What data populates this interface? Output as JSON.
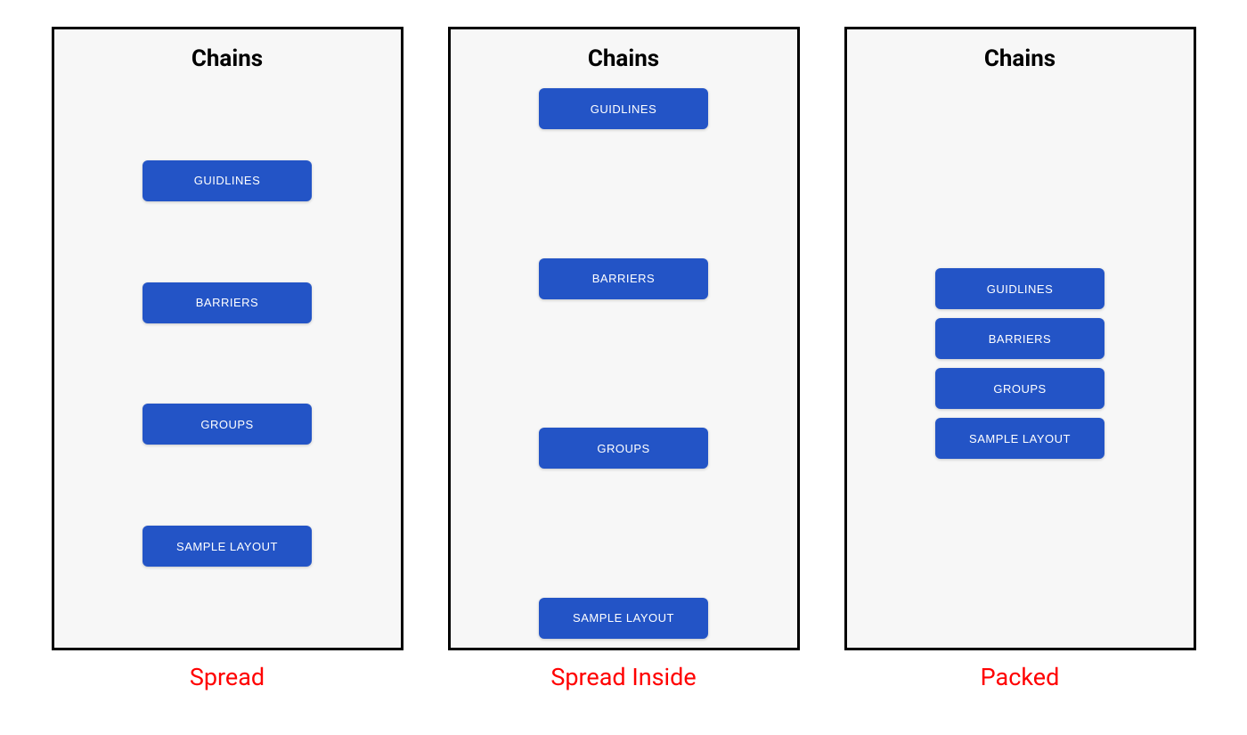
{
  "panels": [
    {
      "title": "Chains",
      "caption": "Spread",
      "layout": "spread",
      "buttons": [
        "GUIDLINES",
        "BARRIERS",
        "GROUPS",
        "SAMPLE LAYOUT"
      ]
    },
    {
      "title": "Chains",
      "caption": "Spread Inside",
      "layout": "spread-inside",
      "buttons": [
        "GUIDLINES",
        "BARRIERS",
        "GROUPS",
        "SAMPLE LAYOUT"
      ]
    },
    {
      "title": "Chains",
      "caption": "Packed",
      "layout": "packed",
      "buttons": [
        "GUIDLINES",
        "BARRIERS",
        "GROUPS",
        "SAMPLE LAYOUT"
      ]
    }
  ],
  "colors": {
    "button_bg": "#2354c6",
    "button_text": "#ffffff",
    "panel_bg": "#f7f7f7",
    "caption_color": "#ff0000",
    "border_color": "#000000"
  }
}
